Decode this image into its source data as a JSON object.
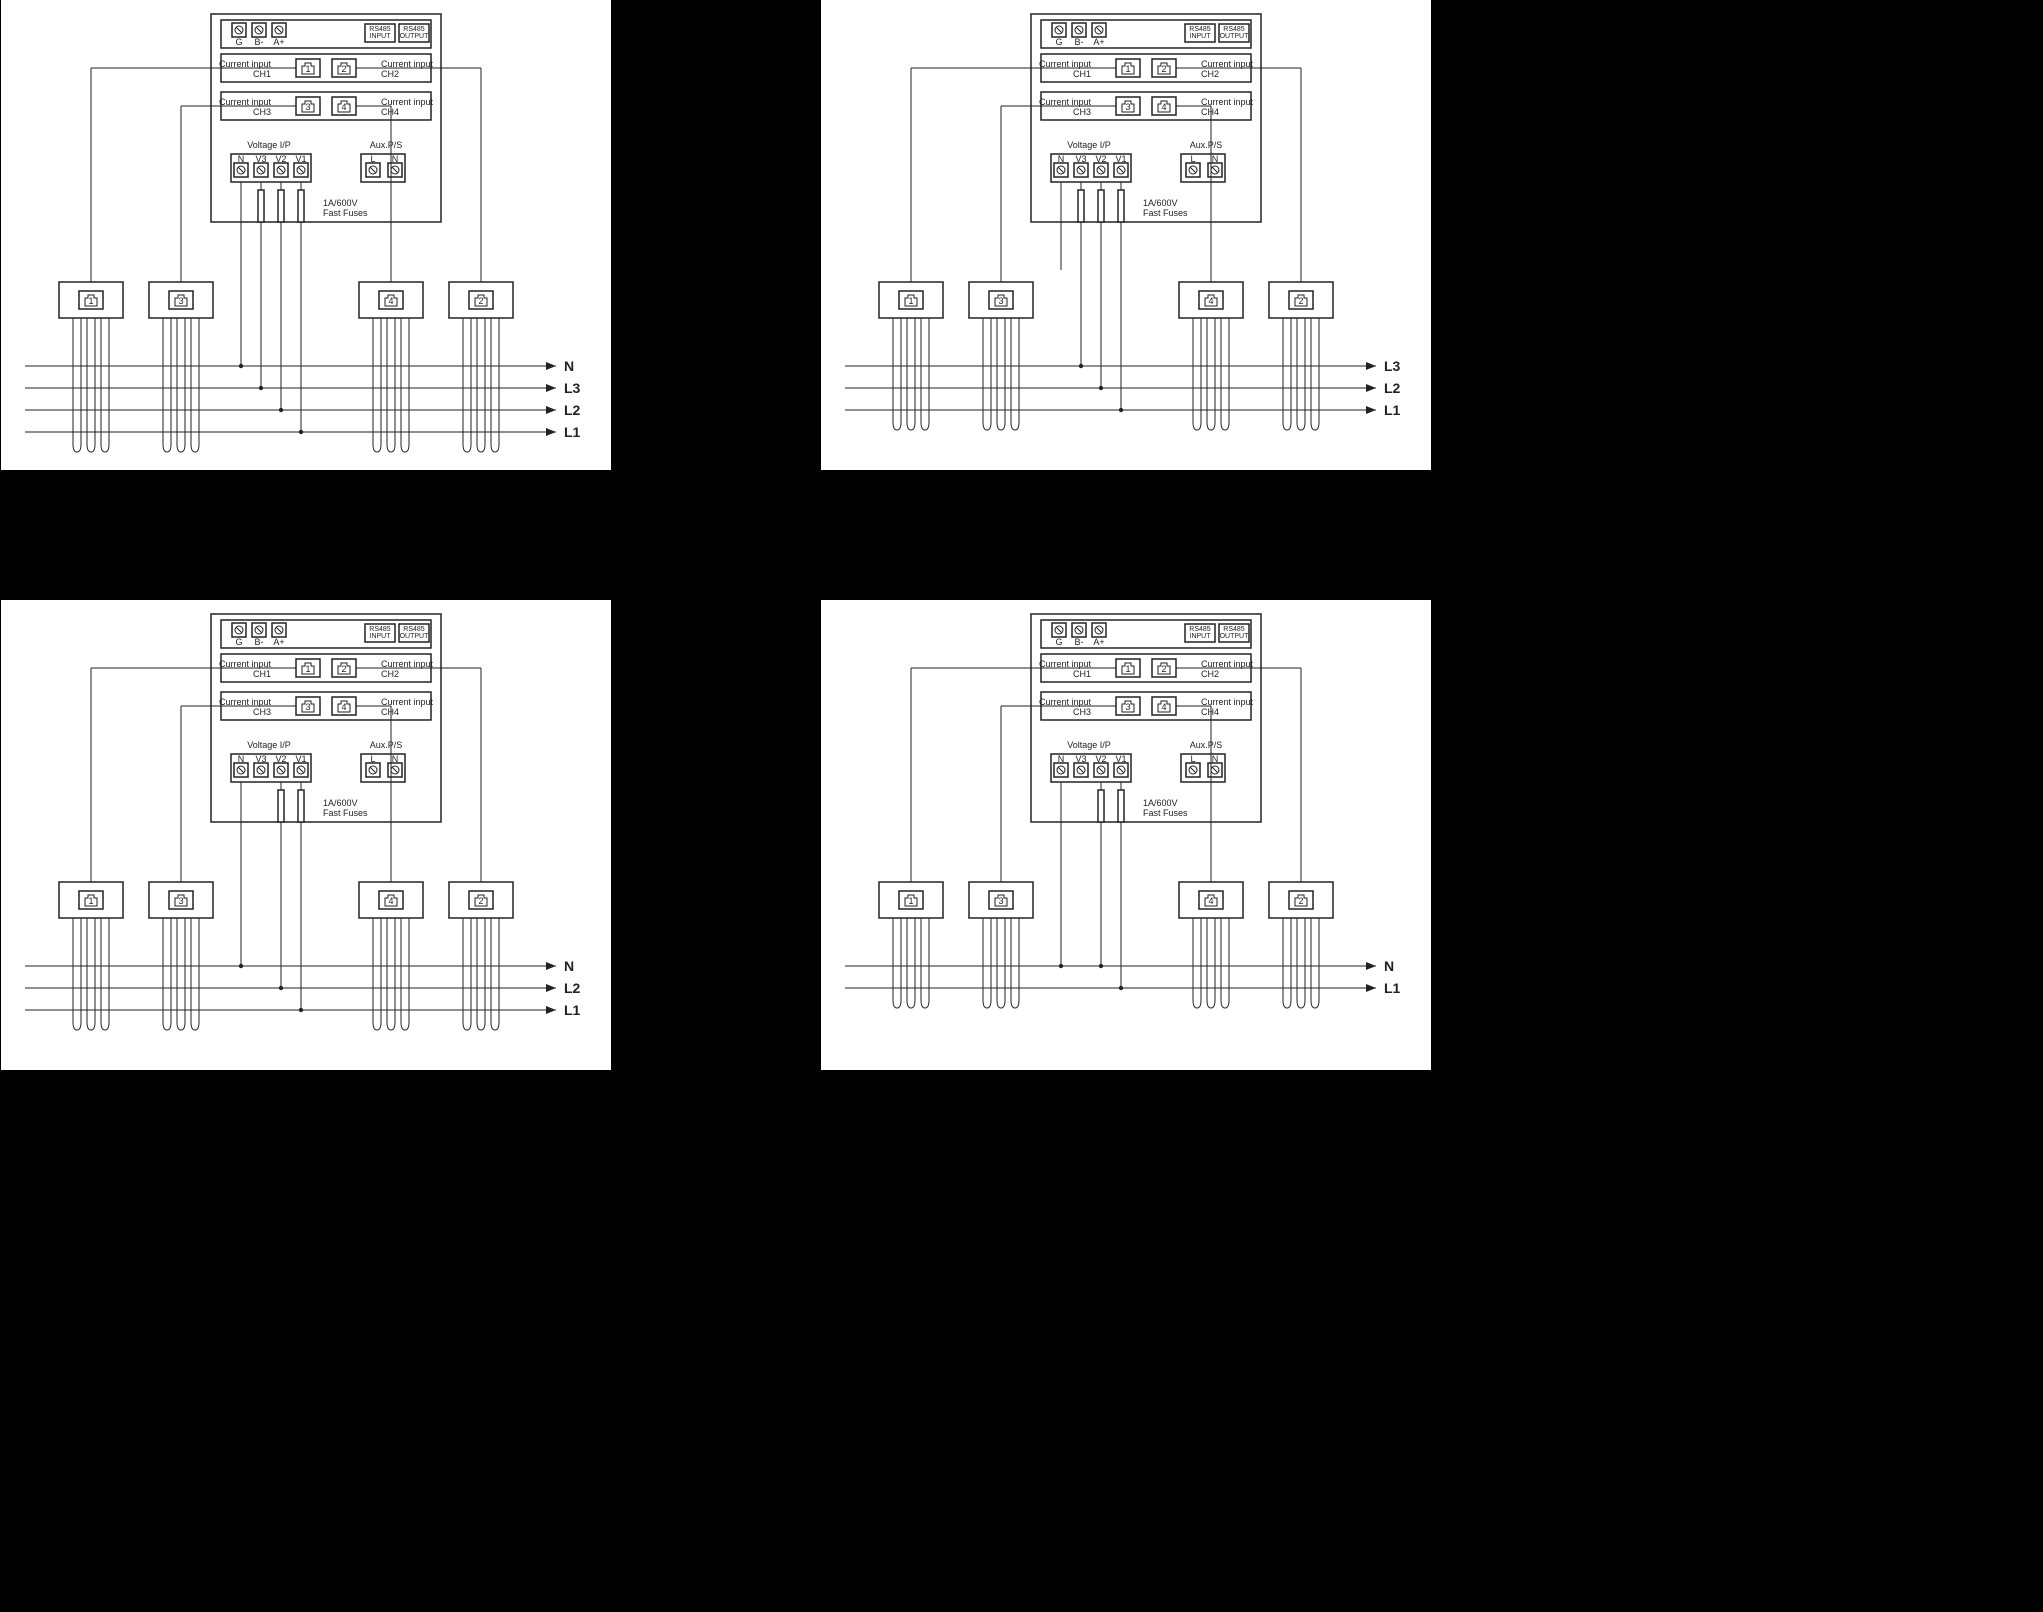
{
  "meter": {
    "comm_terminals": [
      "G",
      "B-",
      "A+"
    ],
    "rs485_in": "RS485\nINPUT",
    "rs485_out": "RS485\nOUTPUT",
    "ch_left_top": {
      "label": "Current input",
      "sub": "CH1"
    },
    "ch_right_top": {
      "label": "Current input",
      "sub": "CH2"
    },
    "ch_left_bot": {
      "label": "Current input",
      "sub": "CH3"
    },
    "ch_right_bot": {
      "label": "Current input",
      "sub": "CH4"
    },
    "voltage_hdr": "Voltage I/P",
    "voltage_terminals": [
      "N",
      "V3",
      "V2",
      "V1"
    ],
    "aux_hdr": "Aux.P/S",
    "aux_terminals": [
      "L",
      "N"
    ],
    "fuse_note": "1A/600V\nFast Fuses"
  },
  "ct_labels": [
    "1",
    "3",
    "4",
    "2"
  ],
  "quad": [
    {
      "phases": [
        "N",
        "L3",
        "L2",
        "L1"
      ],
      "voltage_used": [
        "N",
        "V3",
        "V2",
        "V1"
      ]
    },
    {
      "phases": [
        "L3",
        "L2",
        "L1"
      ],
      "voltage_used": [
        "N",
        "V3",
        "V2",
        "V1"
      ]
    },
    {
      "phases": [
        "N",
        "L2",
        "L1"
      ],
      "voltage_used": [
        "N",
        "V2",
        "V1"
      ]
    },
    {
      "phases": [
        "N",
        "L1"
      ],
      "voltage_used": [
        "N",
        "V2",
        "V1"
      ]
    }
  ]
}
